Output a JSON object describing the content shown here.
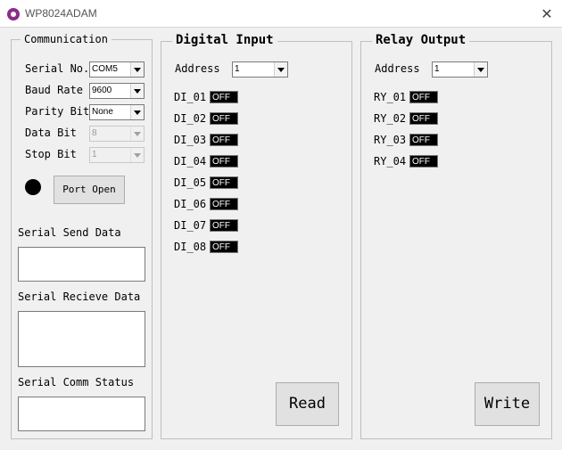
{
  "window": {
    "title": "WP8024ADAM",
    "close_glyph": "✕"
  },
  "communication": {
    "group_title": "Communication",
    "serial_no": {
      "label": "Serial No.",
      "value": "COM5"
    },
    "baud_rate": {
      "label": "Baud Rate",
      "value": "9600"
    },
    "parity_bit": {
      "label": "Parity Bit",
      "value": "None"
    },
    "data_bit": {
      "label": "Data Bit",
      "value": "8"
    },
    "stop_bit": {
      "label": "Stop Bit",
      "value": "1"
    },
    "port_open_label": "Port Open",
    "send_label": "Serial Send Data",
    "receive_label": "Serial Recieve Data",
    "status_label": "Serial Comm Status"
  },
  "digital_input": {
    "group_title": "Digital Input",
    "address_label": "Address",
    "address_value": "1",
    "items": [
      {
        "label": "DI_01",
        "state": "OFF"
      },
      {
        "label": "DI_02",
        "state": "OFF"
      },
      {
        "label": "DI_03",
        "state": "OFF"
      },
      {
        "label": "DI_04",
        "state": "OFF"
      },
      {
        "label": "DI_05",
        "state": "OFF"
      },
      {
        "label": "DI_06",
        "state": "OFF"
      },
      {
        "label": "DI_07",
        "state": "OFF"
      },
      {
        "label": "DI_08",
        "state": "OFF"
      }
    ],
    "read_label": "Read"
  },
  "relay_output": {
    "group_title": "Relay Output",
    "address_label": "Address",
    "address_value": "1",
    "items": [
      {
        "label": "RY_01",
        "state": "OFF"
      },
      {
        "label": "RY_02",
        "state": "OFF"
      },
      {
        "label": "RY_03",
        "state": "OFF"
      },
      {
        "label": "RY_04",
        "state": "OFF"
      }
    ],
    "write_label": "Write"
  }
}
